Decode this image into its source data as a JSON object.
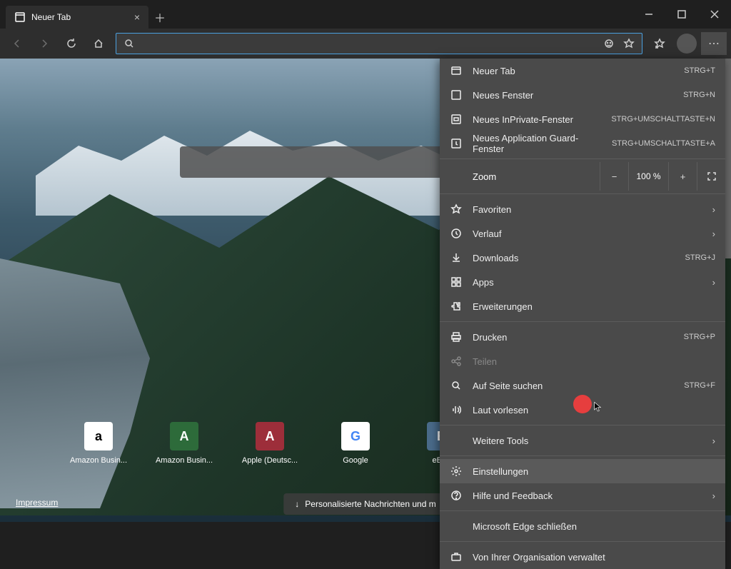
{
  "tab": {
    "title": "Neuer Tab"
  },
  "tiles": [
    {
      "label": "Amazon Busin...",
      "bg": "#fff",
      "fg": "#000",
      "letter": "a"
    },
    {
      "label": "Amazon Busin...",
      "bg": "#2d6b3a",
      "fg": "#fff",
      "letter": "A"
    },
    {
      "label": "Apple (Deutsc...",
      "bg": "#9d2e3a",
      "fg": "#fff",
      "letter": "A"
    },
    {
      "label": "Google",
      "bg": "#fff",
      "fg": "#4285f4",
      "letter": "G"
    },
    {
      "label": "eBay",
      "bg": "#4a6b8a",
      "fg": "#fff",
      "letter": "E"
    }
  ],
  "impressum": "Impressum",
  "news": "Personalisierte Nachrichten und m",
  "zoom": {
    "label": "Zoom",
    "value": "100 %"
  },
  "menu": {
    "new_tab": {
      "label": "Neuer Tab",
      "short": "STRG+T"
    },
    "new_window": {
      "label": "Neues Fenster",
      "short": "STRG+N"
    },
    "new_inprivate": {
      "label": "Neues InPrivate-Fenster",
      "short": "STRG+UMSCHALTTASTE+N"
    },
    "new_appguard": {
      "label": "Neues Application Guard-Fenster",
      "short": "STRG+UMSCHALTTASTE+A"
    },
    "favorites": {
      "label": "Favoriten"
    },
    "history": {
      "label": "Verlauf"
    },
    "downloads": {
      "label": "Downloads",
      "short": "STRG+J"
    },
    "apps": {
      "label": "Apps"
    },
    "extensions": {
      "label": "Erweiterungen"
    },
    "print": {
      "label": "Drucken",
      "short": "STRG+P"
    },
    "share": {
      "label": "Teilen"
    },
    "find": {
      "label": "Auf Seite suchen",
      "short": "STRG+F"
    },
    "read_aloud": {
      "label": "Laut vorlesen"
    },
    "more_tools": {
      "label": "Weitere Tools"
    },
    "settings": {
      "label": "Einstellungen"
    },
    "help": {
      "label": "Hilfe und Feedback"
    },
    "close": {
      "label": "Microsoft Edge schließen"
    },
    "managed": {
      "label": "Von Ihrer Organisation verwaltet"
    }
  }
}
